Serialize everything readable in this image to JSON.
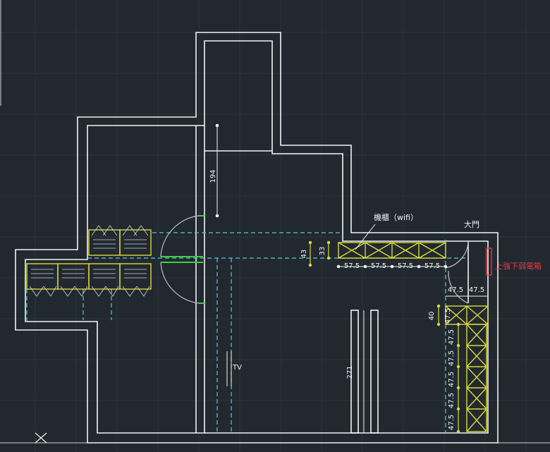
{
  "colors": {
    "background": "#212830",
    "grid": "#2c333c",
    "wall": "#f2f2f2",
    "cabinet": "#dada3a",
    "cyan": "#5fc6cf",
    "green": "#3fcf3f",
    "red": "#e23b3b",
    "door": "#b9bec4"
  },
  "labels": {
    "dim_194": "194",
    "machine_cabinet": "機櫃（wifi）",
    "main_door": "大門",
    "dim_43": "43",
    "dim_33": "33",
    "dim_57_5_a": "57.5",
    "dim_57_5_b": "57.5",
    "dim_57_5_c": "57.5",
    "dim_57_5_d": "57.5",
    "electric_box": "上強下弱電箱",
    "dim_47_5_top_a": "47.5",
    "dim_47_5_top_b": "47.5",
    "dim_40": "40",
    "dim_47_5_side": "47.5",
    "dim_47_5_v1": "47.5",
    "dim_47_5_v2": "47.5",
    "dim_47_5_v3": "47.5",
    "dim_47_5_v4": "47.5",
    "dim_47_5_v5": "47.5",
    "tv": "TV",
    "dim_271": "271"
  }
}
